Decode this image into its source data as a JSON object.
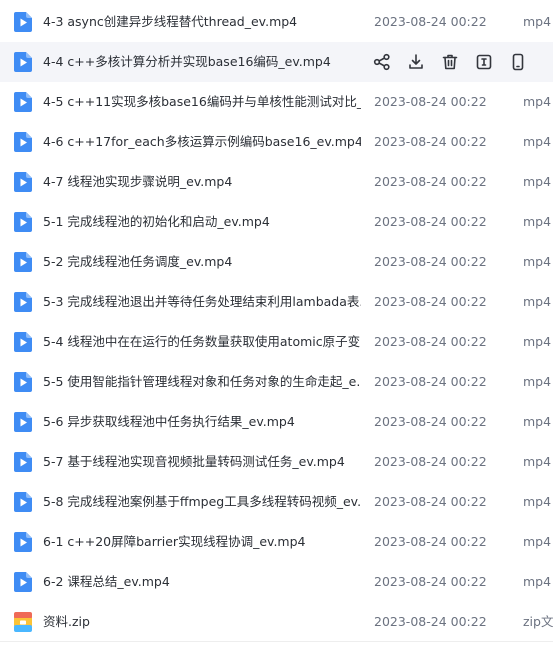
{
  "files": [
    {
      "name": "4-3 async创建异步线程替代thread_ev.mp4",
      "date": "2023-08-24 00:22",
      "type": "mp4",
      "icon": "video-file-icon"
    },
    {
      "name": "4-4 c++多核计算分析并实现base16编码_ev.mp4",
      "date": "",
      "type": "",
      "icon": "video-file-icon"
    },
    {
      "name": "4-5 c++11实现多核base16编码并与单核性能测试对比_...",
      "date": "2023-08-24 00:22",
      "type": "mp4",
      "icon": "video-file-icon"
    },
    {
      "name": "4-6 c++17for_each多核运算示例编码base16_ev.mp4",
      "date": "2023-08-24 00:22",
      "type": "mp4",
      "icon": "video-file-icon"
    },
    {
      "name": "4-7 线程池实现步骤说明_ev.mp4",
      "date": "2023-08-24 00:22",
      "type": "mp4",
      "icon": "video-file-icon"
    },
    {
      "name": "5-1 完成线程池的初始化和启动_ev.mp4",
      "date": "2023-08-24 00:22",
      "type": "mp4",
      "icon": "video-file-icon"
    },
    {
      "name": "5-2 完成线程池任务调度_ev.mp4",
      "date": "2023-08-24 00:22",
      "type": "mp4",
      "icon": "video-file-icon"
    },
    {
      "name": "5-3 完成线程池退出并等待任务处理结束利用lambada表...",
      "date": "2023-08-24 00:22",
      "type": "mp4",
      "icon": "video-file-icon"
    },
    {
      "name": "5-4 线程池中在在运行的任务数量获取使用atomic原子变...",
      "date": "2023-08-24 00:22",
      "type": "mp4",
      "icon": "video-file-icon"
    },
    {
      "name": "5-5 使用智能指针管理线程对象和任务对象的生命走起_e...",
      "date": "2023-08-24 00:22",
      "type": "mp4",
      "icon": "video-file-icon"
    },
    {
      "name": "5-6 异步获取线程池中任务执行结果_ev.mp4",
      "date": "2023-08-24 00:22",
      "type": "mp4",
      "icon": "video-file-icon"
    },
    {
      "name": "5-7 基于线程池实现音视频批量转码测试任务_ev.mp4",
      "date": "2023-08-24 00:22",
      "type": "mp4",
      "icon": "video-file-icon"
    },
    {
      "name": "5-8 完成线程池案例基于ffmpeg工具多线程转码视频_ev....",
      "date": "2023-08-24 00:22",
      "type": "mp4",
      "icon": "video-file-icon"
    },
    {
      "name": "6-1 c++20屏障barrier实现线程协调_ev.mp4",
      "date": "2023-08-24 00:22",
      "type": "mp4",
      "icon": "video-file-icon"
    },
    {
      "name": "6-2 课程总结_ev.mp4",
      "date": "2023-08-24 00:22",
      "type": "mp4",
      "icon": "video-file-icon"
    },
    {
      "name": "资料.zip",
      "date": "2023-08-24 00:22",
      "type": "zip文",
      "icon": "zip-file-icon"
    }
  ],
  "hover_actions": [
    {
      "name": "share-icon"
    },
    {
      "name": "download-icon"
    },
    {
      "name": "delete-icon"
    },
    {
      "name": "rename-icon"
    },
    {
      "name": "phone-icon"
    }
  ],
  "colors": {
    "video_icon": "#3f8cf4",
    "zip_top": "#ef6a57",
    "zip_mid": "#fbc338",
    "zip_bottom": "#4ab7ff",
    "row_hover": "#f4f5f9",
    "action_icon": "#33363d"
  }
}
